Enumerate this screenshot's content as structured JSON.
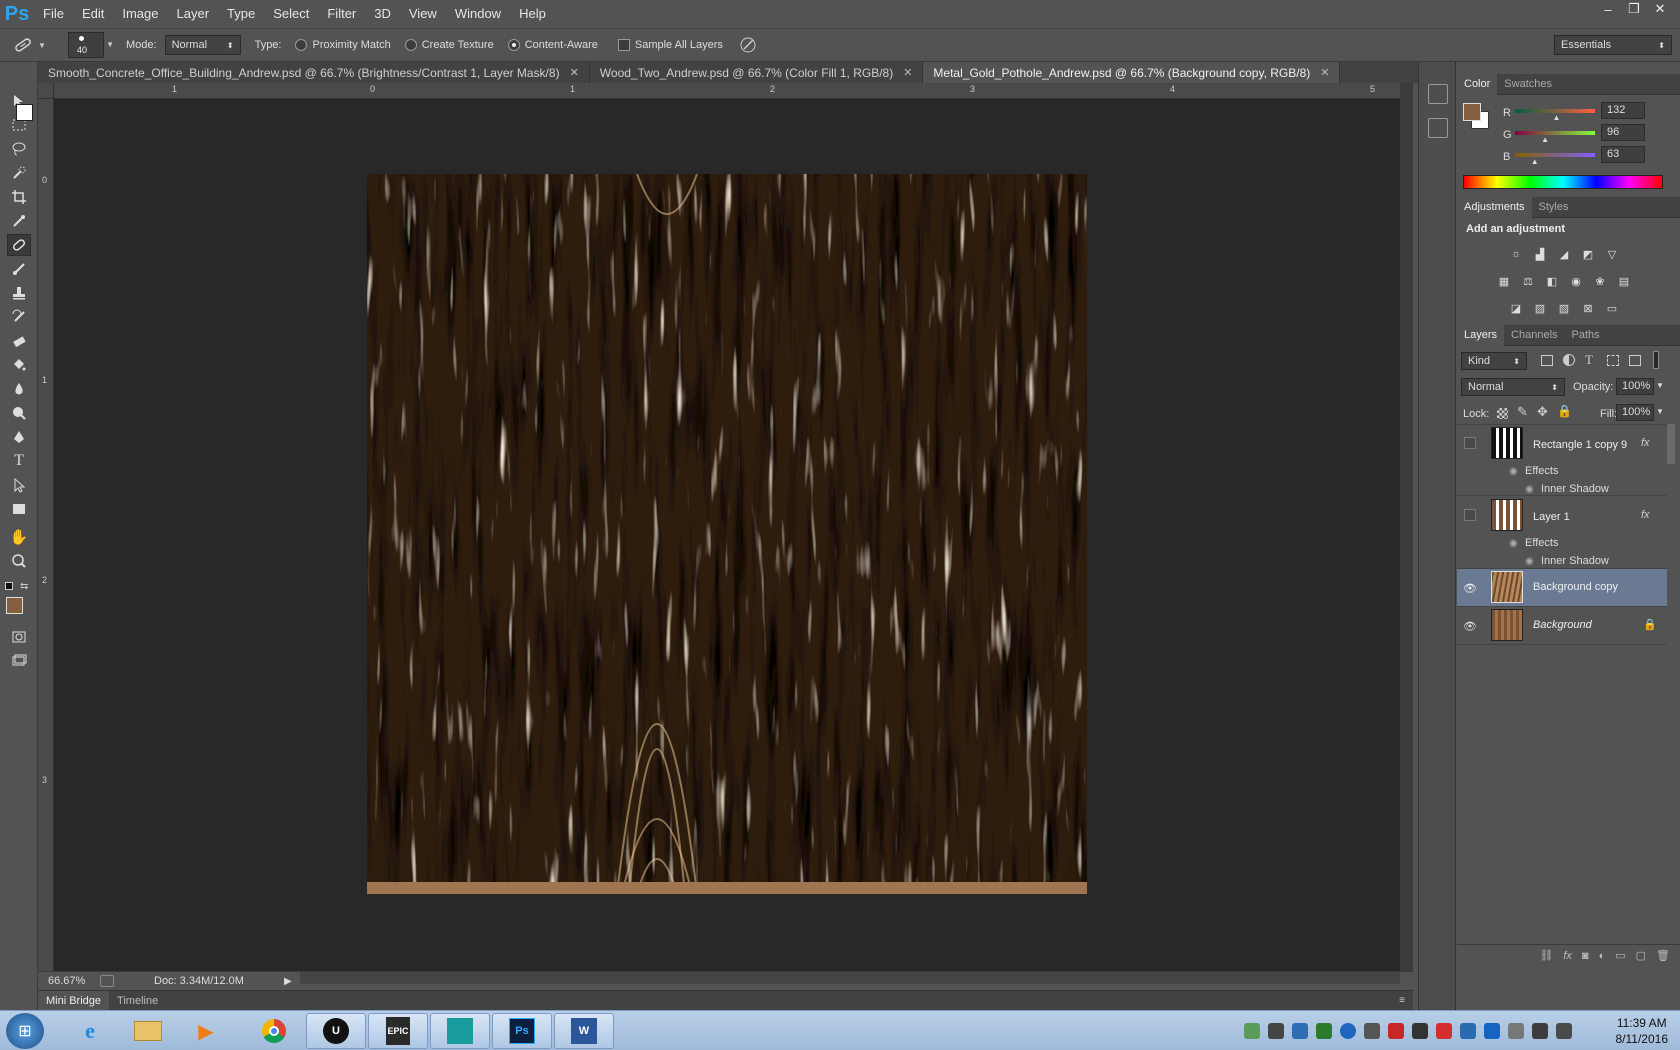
{
  "app": {
    "logo": "Ps"
  },
  "menu": [
    "File",
    "Edit",
    "Image",
    "Layer",
    "Type",
    "Select",
    "Filter",
    "3D",
    "View",
    "Window",
    "Help"
  ],
  "window_controls": {
    "minimize": "‒",
    "restore": "❐",
    "close": "✕"
  },
  "options": {
    "brush_size": "40",
    "mode_label": "Mode:",
    "mode_value": "Normal",
    "type_label": "Type:",
    "proximity_match": "Proximity Match",
    "create_texture": "Create Texture",
    "content_aware": "Content-Aware",
    "sample_all_layers": "Sample All Layers",
    "workspace": "Essentials"
  },
  "tabs": [
    {
      "label": "Smooth_Concrete_Office_Building_Andrew.psd @ 66.7% (Brightness/Contrast 1, Layer Mask/8)",
      "active": false
    },
    {
      "label": "Wood_Two_Andrew.psd @ 66.7% (Color Fill 1, RGB/8)",
      "active": false
    },
    {
      "label": "Metal_Gold_Pothole_Andrew.psd @ 66.7% (Background copy, RGB/8)",
      "active": true
    }
  ],
  "ruler": {
    "top": [
      "1",
      "0",
      "1",
      "2",
      "3",
      "4",
      "5"
    ],
    "left": [
      "0",
      "1",
      "2",
      "3"
    ]
  },
  "status": {
    "zoom": "66.67%",
    "doc": "Doc: 3.34M/12.0M"
  },
  "bottom_tabs": [
    "Mini Bridge",
    "Timeline"
  ],
  "color_panel": {
    "tabs": [
      "Color",
      "Swatches"
    ],
    "foreground_hex": "#845f3f",
    "channels": [
      {
        "label": "R",
        "value": "132",
        "level": 0.518
      },
      {
        "label": "G",
        "value": "96",
        "level": 0.376
      },
      {
        "label": "B",
        "value": "63",
        "level": 0.247
      }
    ]
  },
  "adjustments_panel": {
    "tabs": [
      "Adjustments",
      "Styles"
    ],
    "title": "Add an adjustment"
  },
  "layers_panel": {
    "tabs": [
      "Layers",
      "Channels",
      "Paths"
    ],
    "filter_kind": "Kind",
    "blend_mode": "Normal",
    "opacity_label": "Opacity:",
    "opacity_value": "100%",
    "lock_label": "Lock:",
    "fill_label": "Fill:",
    "fill_value": "100%",
    "layers": [
      {
        "name": "Rectangle 1 copy 9",
        "visible": false,
        "fx": "fx",
        "effects_label": "Effects",
        "effect": "Inner Shadow"
      },
      {
        "name": "Layer 1",
        "visible": false,
        "fx": "fx",
        "effects_label": "Effects",
        "effect": "Inner Shadow"
      },
      {
        "name": "Background copy",
        "visible": true,
        "selected": true
      },
      {
        "name": "Background",
        "visible": true,
        "locked": true
      }
    ]
  },
  "taskbar": {
    "clock_time": "11:39 AM",
    "clock_date": "8/11/2016",
    "apps": [
      "windows-start",
      "internet-explorer",
      "file-explorer",
      "media-player",
      "chrome",
      "unreal-engine",
      "epic-games",
      "3ds-max",
      "photoshop",
      "word"
    ]
  }
}
